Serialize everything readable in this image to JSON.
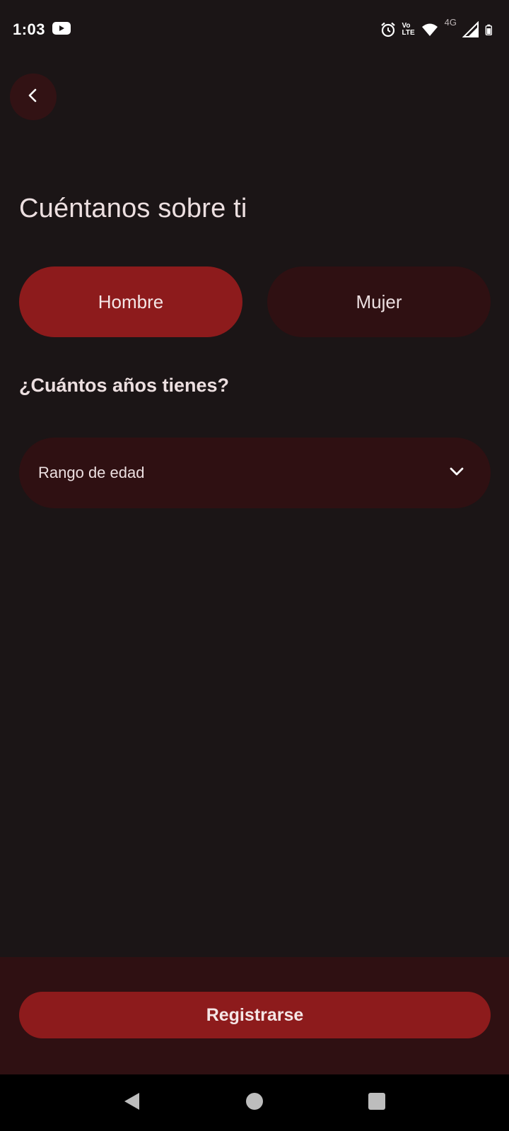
{
  "status_bar": {
    "time": "1:03",
    "notification_icons": [
      "youtube-icon"
    ],
    "system_icons": [
      "alarm-icon",
      "volte-icon",
      "wifi-icon",
      "4g-icon",
      "signal-icon",
      "battery-icon"
    ],
    "volte_top": "Vo",
    "volte_bottom": "LTE",
    "network_type": "4G"
  },
  "header": {
    "back_icon": "chevron-left-icon"
  },
  "main": {
    "title": "Cuéntanos sobre ti",
    "gender_options": [
      {
        "label": "Hombre",
        "selected": true
      },
      {
        "label": "Mujer",
        "selected": false
      }
    ],
    "age_question": "¿Cuántos años tienes?",
    "age_select": {
      "placeholder": "Rango de edad",
      "icon": "chevron-down-icon"
    }
  },
  "footer": {
    "register_label": "Registrarse"
  },
  "nav_bar": {
    "buttons": [
      "back-triangle-icon",
      "home-circle-icon",
      "recents-square-icon"
    ]
  },
  "colors": {
    "background": "#1b1516",
    "surface": "#2f1012",
    "accent": "#8d1b1c",
    "text": "#ecdfe0"
  }
}
